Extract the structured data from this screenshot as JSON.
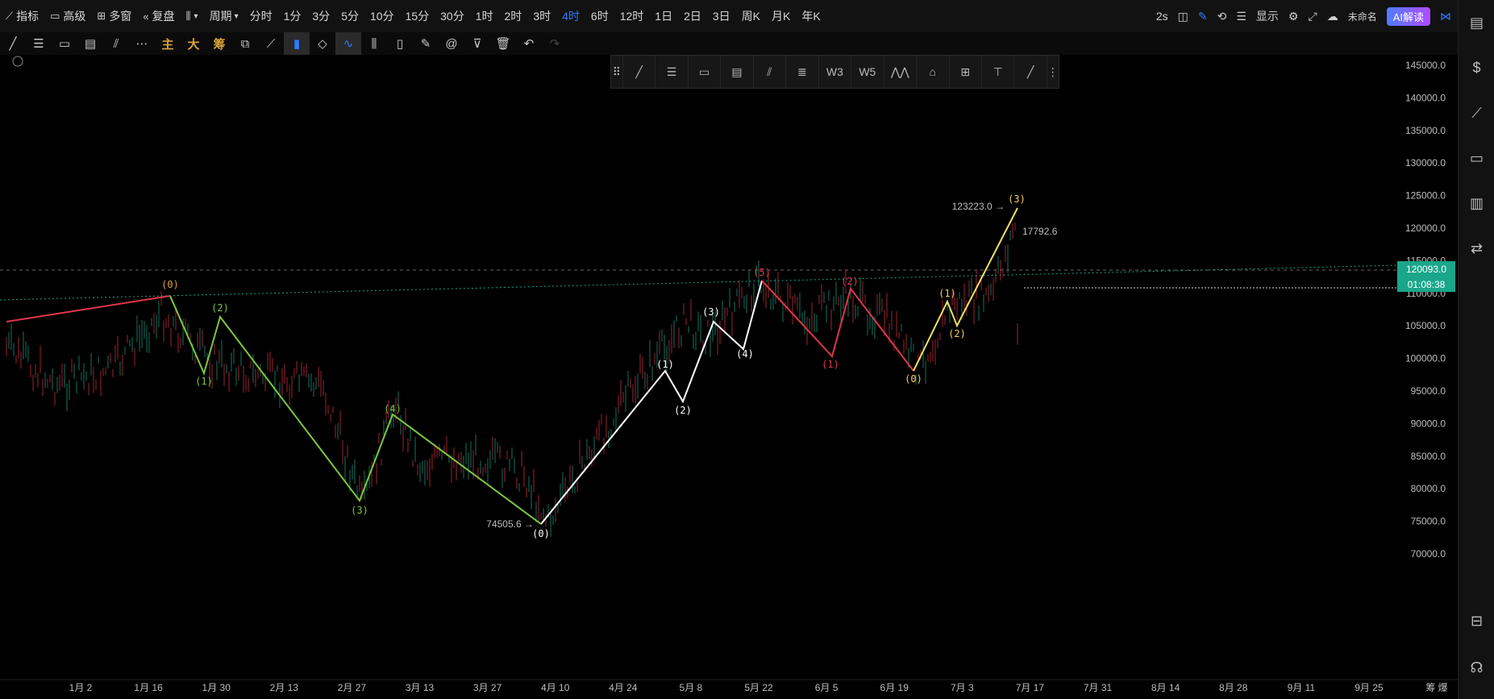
{
  "topbar": {
    "items": [
      {
        "label": "指标",
        "icon": "chart-line-icon"
      },
      {
        "label": "高级",
        "icon": "calendar-icon"
      },
      {
        "label": "多窗",
        "icon": "grid-icon"
      },
      {
        "label": "复盘",
        "icon": "rewind-icon"
      },
      {
        "label": "",
        "icon": "candle-type-icon"
      },
      {
        "label": "周期",
        "icon": "chevron-down-icon"
      }
    ],
    "periods": [
      "分时",
      "1分",
      "3分",
      "5分",
      "10分",
      "15分",
      "30分",
      "1时",
      "2时",
      "3时",
      "4时",
      "6时",
      "12时",
      "1日",
      "2日",
      "3日",
      "周K",
      "月K",
      "年K"
    ],
    "active_period": "4时",
    "right": {
      "interval": "2s",
      "display": "显示",
      "layout_name": "未命名",
      "ai_button": "AI解读"
    }
  },
  "toolbar2": {
    "labels": {
      "main": "主",
      "large": "大",
      "chips": "筹"
    }
  },
  "chart": {
    "price_axis": [
      "145000.0",
      "140000.0",
      "135000.0",
      "130000.0",
      "125000.0",
      "120000.0",
      "115000.0",
      "110000.0",
      "105000.0",
      "100000.0",
      "95000.0",
      "90000.0",
      "85000.0",
      "80000.0",
      "75000.0",
      "70000.0"
    ],
    "date_axis": [
      "1月 2",
      "1月 16",
      "1月 30",
      "2月 13",
      "2月 27",
      "3月 13",
      "3月 27",
      "4月 10",
      "4月 24",
      "5月 8",
      "5月 22",
      "6月 5",
      "6月 19",
      "7月 3",
      "7月 17",
      "7月 31",
      "8月 14",
      "8月 28",
      "9月 11",
      "9月 25"
    ],
    "date_axis_right": "筹 爆",
    "current_price": "120093.0",
    "countdown": "01:08:38",
    "high_label": "123223.0",
    "low_label": "74505.6",
    "side_label": "17792.6",
    "colors": {
      "green_wave": "#7cc63e",
      "white_wave": "#ffffff",
      "red_wave": "#e0364a",
      "yellow_wave": "#f0e060",
      "tag": "#1aa68a"
    }
  },
  "wave_labels": {
    "green": [
      "(0)",
      "(1)",
      "(2)",
      "(3)",
      "(4)",
      "(0)"
    ],
    "white": [
      "(0)",
      "(1)",
      "(2)",
      "(3)",
      "(4)",
      "(5)"
    ],
    "red": [
      "(1)",
      "(2)"
    ],
    "yellow": [
      "(0)",
      "(1)",
      "(2)",
      "(3)"
    ]
  }
}
